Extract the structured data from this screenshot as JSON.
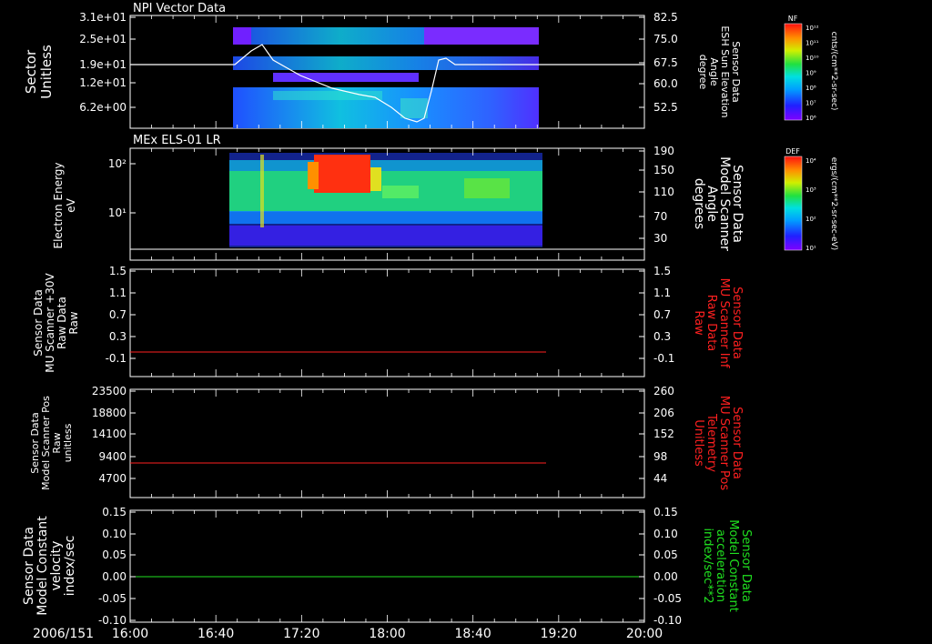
{
  "date_label": "2006/151",
  "time_ticks": [
    "16:00",
    "16:40",
    "17:20",
    "18:00",
    "18:40",
    "19:20",
    "20:00"
  ],
  "colors": {
    "red": "#ff2020",
    "green": "#20e020",
    "white": "#ffffff",
    "frame": "#ffffff",
    "background": "#000000"
  },
  "panels": [
    {
      "id": "npi",
      "title": "NPI Vector Data",
      "left_label": [
        "Sector",
        "Unitless"
      ],
      "left_ticks": [
        "3.1e+01",
        "2.5e+01",
        "1.9e+01",
        "1.2e+01",
        "6.2e+00"
      ],
      "right_label": [
        "Sensor Data",
        "ESH Sun Elevation",
        "Angle",
        "degree"
      ],
      "right_ticks": [
        "82.5",
        "75.0",
        "67.5",
        "60.0",
        "52.5"
      ],
      "colorbar": {
        "label": "NF",
        "unit": "cnts/(cm**2-sr-sec)",
        "ticks": [
          "10¹²",
          "10¹¹",
          "10¹⁰",
          "10⁹",
          "10⁸",
          "10⁷",
          "10⁶"
        ]
      }
    },
    {
      "id": "els",
      "title": "MEx ELS-01 LR",
      "left_label": [
        "Electron Energy",
        "eV"
      ],
      "left_ticks": [
        "10²",
        "10¹"
      ],
      "right_label": [
        "Sensor Data",
        "Model Scanner",
        "Angle",
        "degrees"
      ],
      "right_ticks": [
        "190",
        "150",
        "110",
        "70",
        "30"
      ],
      "colorbar": {
        "label": "DEF",
        "unit": "ergs/(cm**2-sr-sec-eV)",
        "ticks": [
          "10⁴",
          "10³",
          "10²",
          "10¹"
        ]
      }
    },
    {
      "id": "mu30",
      "left_label": [
        "Sensor Data",
        "MU Scanner +30V",
        "Raw Data",
        "Raw"
      ],
      "left_ticks": [
        "1.5",
        "1.1",
        "0.7",
        "0.3",
        "-0.1"
      ],
      "right_label": [
        "Sensor Data",
        "MU Scanner Inf",
        "Raw Data",
        "Raw"
      ],
      "right_ticks": [
        "1.5",
        "1.1",
        "0.7",
        "0.3",
        "-0.1"
      ]
    },
    {
      "id": "pos",
      "left_label": [
        "Sensor Data",
        "Model Scanner Pos",
        "Raw",
        "unitless"
      ],
      "left_ticks": [
        "23500",
        "18800",
        "14100",
        "9400",
        "4700"
      ],
      "right_label": [
        "Sensor Data",
        "MU Scanner Pos",
        "Telemetry",
        "Unitless"
      ],
      "right_ticks": [
        "260",
        "206",
        "152",
        "98",
        "44"
      ]
    },
    {
      "id": "vel",
      "left_label": [
        "Sensor Data",
        "Model Constant",
        "velocity",
        "index/sec"
      ],
      "left_ticks": [
        "0.15",
        "0.10",
        "0.05",
        "0.00",
        "-0.05",
        "-0.10"
      ],
      "right_label": [
        "Sensor Data",
        "Model Constant",
        "acceleration",
        "index/sec**2"
      ],
      "right_ticks": [
        "0.15",
        "0.10",
        "0.05",
        "0.00",
        "-0.05",
        "-0.10"
      ]
    }
  ],
  "chart_data": [
    {
      "type": "heatmap",
      "title": "NPI Vector Data",
      "x_range": [
        "16:00",
        "20:00"
      ],
      "ylabel": "Sector Unitless",
      "y_ticks": [
        31,
        25,
        19,
        12,
        6.2
      ],
      "y2label": "Sensor Data ESH Sun Elevation Angle degree",
      "y2_ticks": [
        82.5,
        75.0,
        67.5,
        60.0,
        52.5
      ],
      "data_extent": [
        "16:50",
        "19:15"
      ],
      "overlay_line": {
        "name": "ESH Sun Elevation",
        "x": [
          "16:00",
          "16:52",
          "17:00",
          "17:05",
          "17:20",
          "17:40",
          "18:00",
          "18:10",
          "18:15",
          "18:30",
          "18:35",
          "18:40",
          "18:45",
          "18:50",
          "18:55",
          "19:00",
          "19:15",
          "20:00"
        ],
        "y": [
          67.5,
          67.5,
          70.5,
          72.5,
          68.5,
          64.5,
          61.0,
          58.5,
          57.0,
          56.0,
          54.5,
          50.0,
          48.0,
          49.0,
          58.0,
          68.5,
          67.5,
          67.5
        ]
      }
    },
    {
      "type": "heatmap",
      "title": "MEx ELS-01 LR",
      "x_range": [
        "16:00",
        "20:00"
      ],
      "ylabel": "Electron Energy eV",
      "y_scale": "log",
      "y_ticks": [
        100,
        10
      ],
      "y2label": "Sensor Data Model Scanner Angle degrees",
      "y2_ticks": [
        190,
        150,
        110,
        70,
        30
      ],
      "data_extent": [
        "16:48",
        "19:15"
      ],
      "overlay_line": {
        "name": "Model Scanner Angle",
        "x": [
          "16:00",
          "20:00"
        ],
        "y": [
          22,
          22
        ]
      }
    },
    {
      "type": "line",
      "ylabel": "Sensor Data MU Scanner +30V Raw Data Raw",
      "ylim": [
        -0.3,
        1.5
      ],
      "y2label": "Sensor Data MU Scanner Inf Raw Data Raw",
      "series": [
        {
          "name": "MU Scanner Inf",
          "x": [
            "16:00",
            "19:20"
          ],
          "y": [
            0.0,
            0.0
          ]
        }
      ]
    },
    {
      "type": "line",
      "ylabel": "Sensor Data Model Scanner Pos Raw unitless",
      "ylim": [
        0,
        23500
      ],
      "y2label": "Sensor Data MU Scanner Pos Telemetry Unitless",
      "series": [
        {
          "name": "MU Scanner Pos",
          "x": [
            "16:00",
            "19:20"
          ],
          "y": [
            8000,
            8000
          ]
        }
      ]
    },
    {
      "type": "line",
      "ylabel": "Sensor Data Model Constant velocity index/sec",
      "ylim": [
        -0.1,
        0.15
      ],
      "y2label": "Sensor Data Model Constant acceleration index/sec**2",
      "series": [
        {
          "name": "Model Constant acceleration",
          "x": [
            "16:00",
            "20:00"
          ],
          "y": [
            0.0,
            0.0
          ]
        }
      ]
    }
  ]
}
